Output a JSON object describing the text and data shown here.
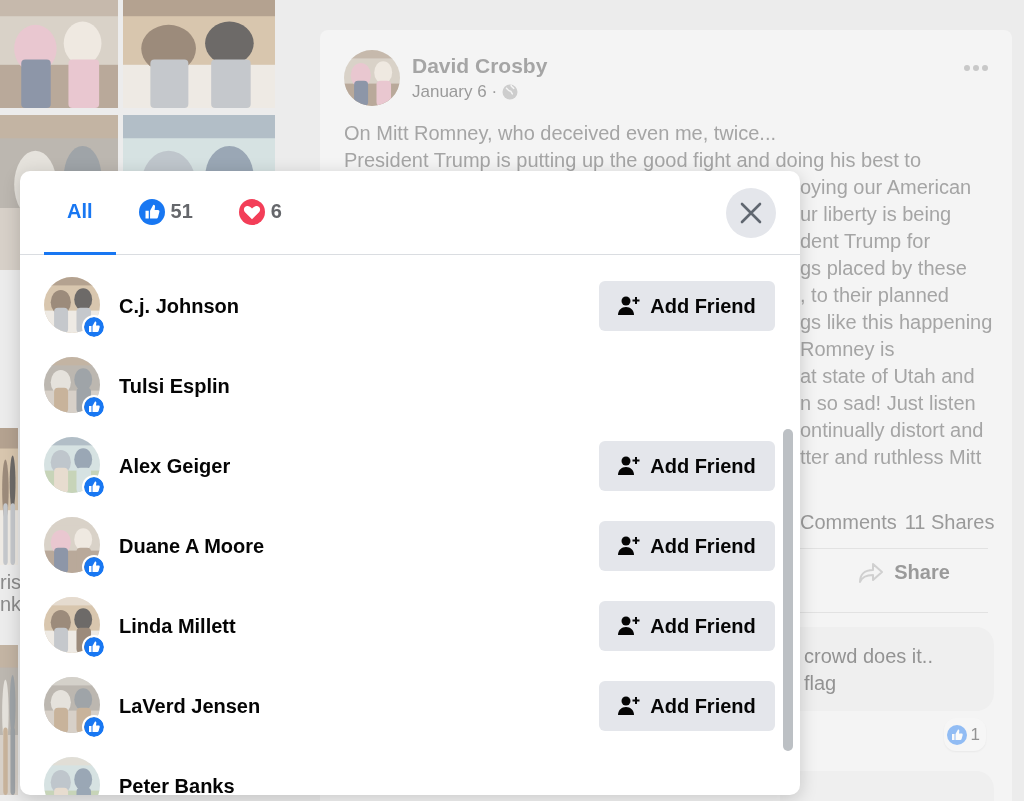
{
  "side_fragments": [
    "ris",
    "nk"
  ],
  "post": {
    "author": "David Crosby",
    "date": "January 6 ·",
    "lines": [
      "On Mitt Romney, who deceived even me, twice...",
      "President Trump is putting up the good fight and doing his best to"
    ],
    "clipped_lines": [
      "oying our American",
      "ur liberty is being",
      "dent Trump for",
      "gs placed by these",
      ", to their planned",
      "gs like this happening",
      "Romney is",
      "at state of Utah and",
      "n so sad! Just listen",
      "ontinually distort and",
      "tter and ruthless Mitt"
    ],
    "comments": "Comments",
    "shares": "11 Shares",
    "share_action": "Share",
    "comment": {
      "lines": [
        "crowd does it..",
        "flag"
      ],
      "reaction_count": "1"
    }
  },
  "dialog": {
    "tabs": [
      {
        "kind": "all",
        "label": "All",
        "selected": true
      },
      {
        "kind": "like",
        "label": "51",
        "selected": false
      },
      {
        "kind": "love",
        "label": "6",
        "selected": false
      }
    ],
    "people": [
      {
        "name": "C.j. Johnson",
        "kind": "like",
        "add_friend": "Add Friend"
      },
      {
        "name": "Tulsi Esplin",
        "kind": "like"
      },
      {
        "name": "Alex Geiger",
        "kind": "like",
        "add_friend": "Add Friend"
      },
      {
        "name": "Duane A Moore",
        "kind": "like",
        "add_friend": "Add Friend"
      },
      {
        "name": "Linda Millett",
        "kind": "like",
        "add_friend": "Add Friend"
      },
      {
        "name": "LaVerd Jensen",
        "kind": "like",
        "add_friend": "Add Friend"
      },
      {
        "name": "Peter Banks"
      }
    ]
  }
}
